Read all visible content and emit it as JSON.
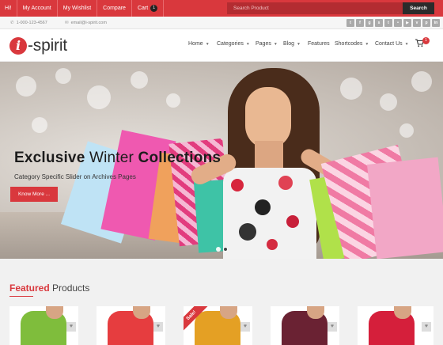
{
  "topbar": {
    "items": [
      {
        "label": "Hi!"
      },
      {
        "label": "My Account"
      },
      {
        "label": "My Wishlist"
      },
      {
        "label": "Compare"
      },
      {
        "label": "Cart"
      }
    ],
    "cart_count": "1",
    "search_placeholder": "Search Product",
    "search_button": "Search"
  },
  "contact": {
    "phone": "1-000-123-4567",
    "email": "email@i-spirit.com"
  },
  "social_icons": [
    "twitter-icon",
    "facebook-icon",
    "google-plus-icon",
    "skype-icon",
    "tumblr-icon",
    "flickr-icon",
    "youtube-icon",
    "vimeo-icon",
    "pinterest-icon",
    "linkedin-icon"
  ],
  "header": {
    "logo_mark": "i",
    "logo_text": "-spirit",
    "nav": [
      {
        "label": "Home",
        "dropdown": true
      },
      {
        "label": "Categories",
        "dropdown": true
      },
      {
        "label": "Pages",
        "dropdown": true
      },
      {
        "label": "Blog",
        "dropdown": true
      },
      {
        "label": "Features",
        "dropdown": false
      },
      {
        "label": "Shortcodes",
        "dropdown": true
      },
      {
        "label": "Contact Us",
        "dropdown": true
      }
    ],
    "cart_badge": "1"
  },
  "hero": {
    "title_bold_1": "Exclusive",
    "title_light": " Winter ",
    "title_bold_2": "Collections",
    "subtitle": "Category Specific Slider on Archives Pages",
    "button": "Know More ..."
  },
  "featured": {
    "title_highlight": "Featured",
    "title_rest": " Products",
    "sale_label": "Sale!",
    "products": [
      {
        "color": "#7fbd3c"
      },
      {
        "color": "#e63d3f"
      },
      {
        "color": "#e4a024"
      },
      {
        "color": "#6a2233"
      },
      {
        "color": "#d51f3b"
      }
    ]
  },
  "colors": {
    "accent": "#d9383d",
    "dark": "#2b2b2b"
  }
}
